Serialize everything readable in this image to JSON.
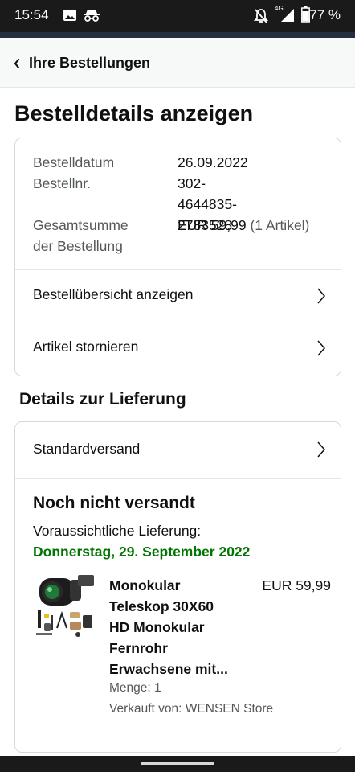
{
  "status_bar": {
    "time": "15:54",
    "battery": "77 %",
    "network": "4G",
    "icons": [
      "image-icon",
      "incognito-icon",
      "notifications-off-icon",
      "signal-icon",
      "battery-icon"
    ]
  },
  "nav": {
    "back_label": "Ihre Bestellungen"
  },
  "page": {
    "title": "Bestelldetails anzeigen"
  },
  "order_summary": {
    "date_label": "Bestelldatum",
    "date_value": "26.09.2022",
    "number_label": "Bestellnr.",
    "number_value_line1": "302-4644835-",
    "number_value_line2": "2783528",
    "total_label_line1": "Gesamtsumme",
    "total_label_line2": "der Bestellung",
    "total_value": "EUR 59,99",
    "total_items": "(1 Artikel)",
    "links": [
      {
        "label": "Bestellübersicht anzeigen"
      },
      {
        "label": "Artikel stornieren"
      }
    ]
  },
  "delivery": {
    "heading": "Details zur Lieferung",
    "shipping_method": "Standardversand",
    "status": "Noch nicht versandt",
    "eta_label": "Voraussichtliche Lieferung:",
    "eta_date": "Donnerstag, 29. September 2022",
    "item": {
      "title_lines": [
        "Monokular",
        "Teleskop 30X60",
        "HD Monokular",
        "Fernrohr",
        "Erwachsene mit..."
      ],
      "price": "EUR 59,99",
      "quantity": "Menge: 1",
      "seller": "Verkauft von: WENSEN Store"
    }
  },
  "colors": {
    "status_bar": "#1a1a1a",
    "accent_bar": "#232f3e",
    "nav_background": "#f7f8f8",
    "eta_green": "#007600",
    "muted_text": "#565959",
    "border": "#d5d9d9"
  }
}
